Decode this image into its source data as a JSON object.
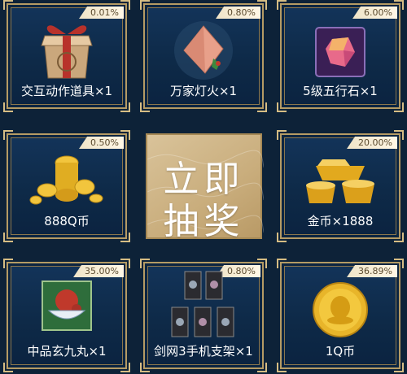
{
  "colors": {
    "frame": "#b59b64",
    "card_bg": "#13345a",
    "badge_bg": "#efe4c8",
    "draw_bg": "#d9c39a"
  },
  "draw_button": {
    "line1": "立即",
    "line2": "抽奖"
  },
  "prizes": [
    {
      "name": "交互动作道具×1",
      "chance": "0.01%",
      "icon": "gift-box-icon"
    },
    {
      "name": "万家灯火×1",
      "chance": "0.80%",
      "icon": "lantern-icon"
    },
    {
      "name": "5级五行石×1",
      "chance": "6.00%",
      "icon": "gem-icon"
    },
    {
      "name": "888Q币",
      "chance": "0.50%",
      "icon": "coin-stack-icon"
    },
    {
      "name": "金币×1888",
      "chance": "20.00%",
      "icon": "gold-ingot-icon"
    },
    {
      "name": "中品玄九丸×1",
      "chance": "35.00%",
      "icon": "pill-bowl-icon"
    },
    {
      "name": "剑网3手机支架×1",
      "chance": "0.80%",
      "icon": "phone-stand-icon"
    },
    {
      "name": "1Q币",
      "chance": "36.89%",
      "icon": "q-coin-icon"
    }
  ]
}
